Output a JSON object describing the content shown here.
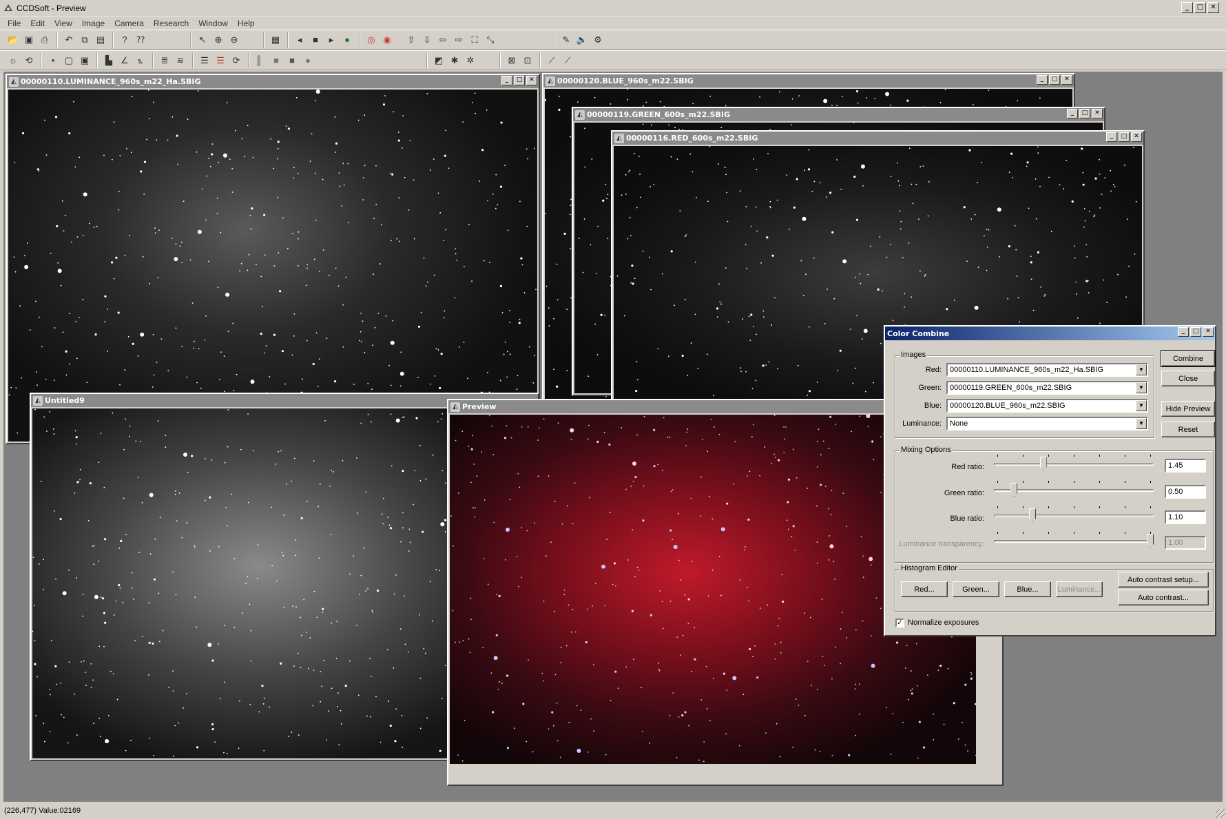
{
  "app": {
    "title": "CCDSoft  - Preview"
  },
  "menu": [
    "File",
    "Edit",
    "View",
    "Image",
    "Camera",
    "Research",
    "Window",
    "Help"
  ],
  "windows": {
    "luminance": {
      "title": "00000110.LUMINANCE_960s_m22_Ha.SBIG"
    },
    "blue": {
      "title": "00000120.BLUE_960s_m22.SBIG"
    },
    "green": {
      "title": "00000119.GREEN_600s_m22.SBIG"
    },
    "red": {
      "title": "00000116.RED_600s_m22.SBIG"
    },
    "untitled": {
      "title": "Untitled9"
    },
    "preview": {
      "title": "Preview"
    }
  },
  "dialog": {
    "title": "Color Combine",
    "images_group": "Images",
    "red_label": "Red:",
    "red_value": "00000110.LUMINANCE_960s_m22_Ha.SBIG",
    "green_label": "Green:",
    "green_value": "00000119.GREEN_600s_m22.SBIG",
    "blue_label": "Blue:",
    "blue_value": "00000120.BLUE_960s_m22.SBIG",
    "lum_label": "Luminance:",
    "lum_value": "None",
    "combine": "Combine",
    "close": "Close",
    "hide_preview": "Hide Preview",
    "reset": "Reset",
    "mixing_group": "Mixing Options",
    "red_ratio_label": "Red ratio:",
    "red_ratio": "1.45",
    "red_ratio_level": 0.3,
    "green_ratio_label": "Green ratio:",
    "green_ratio": "0.50",
    "green_ratio_level": 0.11,
    "blue_ratio_label": "Blue ratio:",
    "blue_ratio": "1.10",
    "blue_ratio_level": 0.23,
    "lum_trans_label": "Luminance transparency:",
    "lum_trans": "1.00",
    "lum_trans_level": 1.0,
    "hist_group": "Histogram Editor",
    "hist_red": "Red...",
    "hist_green": "Green...",
    "hist_blue": "Blue...",
    "hist_lum": "Luminance...",
    "auto_setup": "Auto contrast setup...",
    "auto_contrast": "Auto contrast...",
    "normalize_label": "Normalize exposures",
    "normalize_checked": "✓"
  },
  "status": {
    "text": "(226,477) Value:02169"
  }
}
